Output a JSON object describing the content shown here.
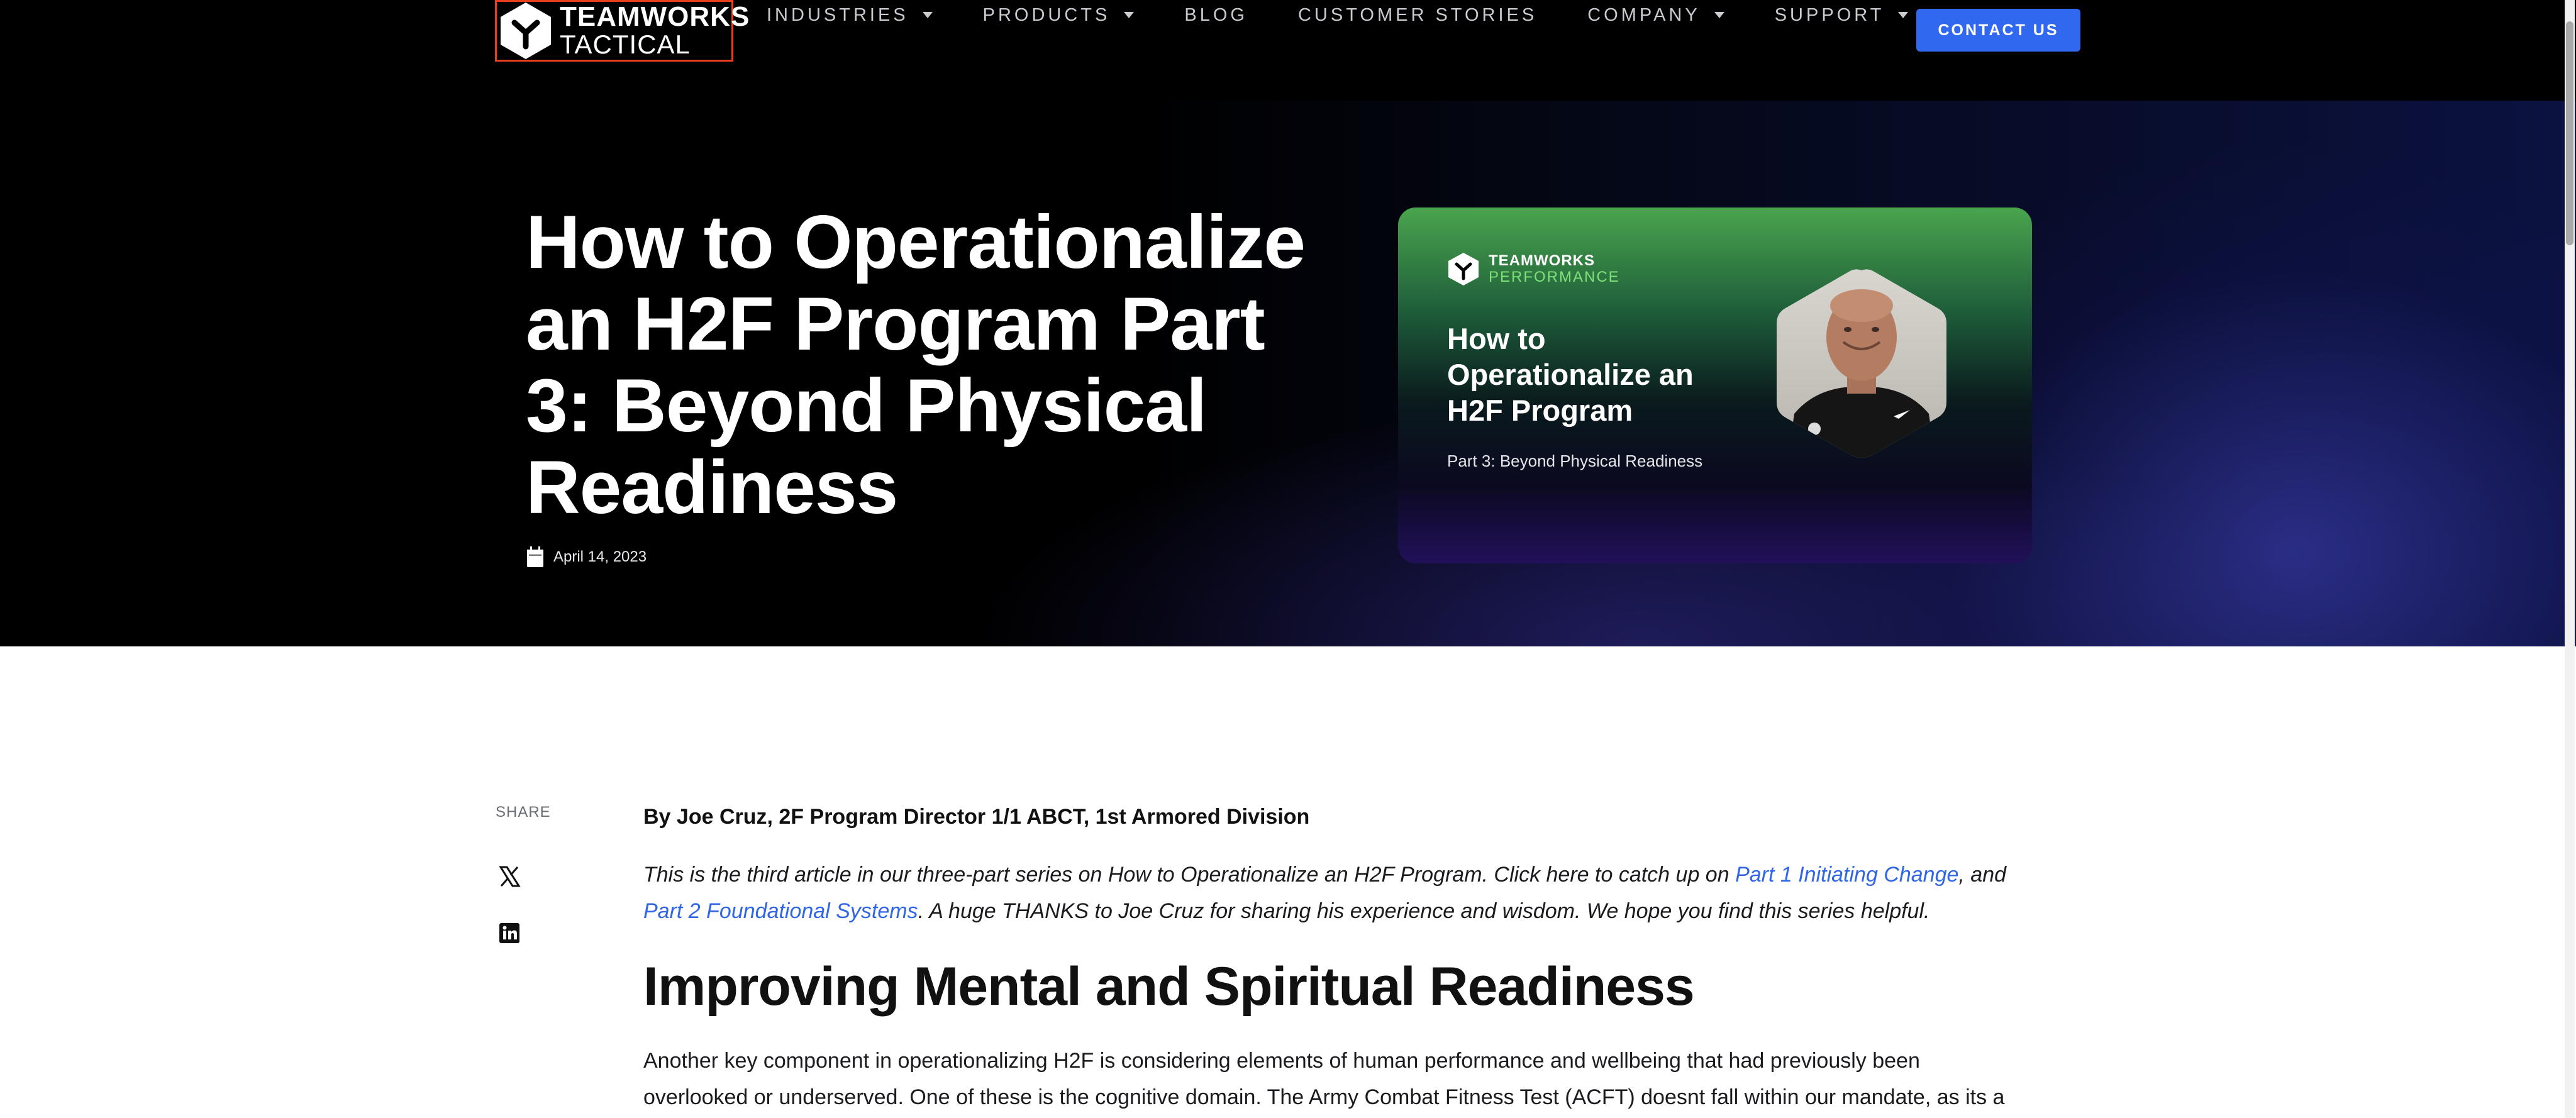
{
  "nav": {
    "logo": {
      "line1": "TEAMWORKS",
      "line2": "TACTICAL"
    },
    "items": [
      {
        "label": "INDUSTRIES",
        "has_menu": true
      },
      {
        "label": "PRODUCTS",
        "has_menu": true
      },
      {
        "label": "BLOG",
        "has_menu": false
      },
      {
        "label": "CUSTOMER STORIES",
        "has_menu": false
      },
      {
        "label": "COMPANY",
        "has_menu": true
      },
      {
        "label": "SUPPORT",
        "has_menu": true
      }
    ],
    "contact_label": "CONTACT US"
  },
  "hero": {
    "title": "How to Operationalize an H2F Program Part 3: Beyond Physical Readiness",
    "date": "April 14, 2023",
    "card": {
      "brand_line1": "TEAMWORKS",
      "brand_line2": "PERFORMANCE",
      "title": "How to Operationalize an H2F Program",
      "subtitle": "Part 3: Beyond Physical Readiness"
    }
  },
  "share": {
    "label": "SHARE",
    "icons": [
      "x-icon",
      "linkedin-icon"
    ]
  },
  "article": {
    "byline": "By Joe Cruz, 2F Program Director 1/1 ABCT, 1st Armored Division",
    "intro_pre": "This is the third article in our three-part series on How to Operationalize an H2F Program. Click here to catch up on ",
    "link1": "Part 1 Initiating Change",
    "intro_mid": ", and ",
    "link2": "Part 2 Foundational Systems",
    "intro_post": ". A huge THANKS to Joe Cruz for sharing his experience and wisdom. We hope you find this series helpful.",
    "heading": "Improving Mental and Spiritual Readiness",
    "paragraph": "Another key component in operationalizing H2F is considering elements of human performance and wellbeing that had previously been overlooked or underserved. One of these is the cognitive domain. The Army Combat Fitness Test (ACFT) doesnt fall within our mandate, as its a unit"
  },
  "colors": {
    "accent": "#3168f0",
    "link": "#2f65e6",
    "logo_outline": "#e8401f",
    "performance_green": "#7fe07a"
  }
}
